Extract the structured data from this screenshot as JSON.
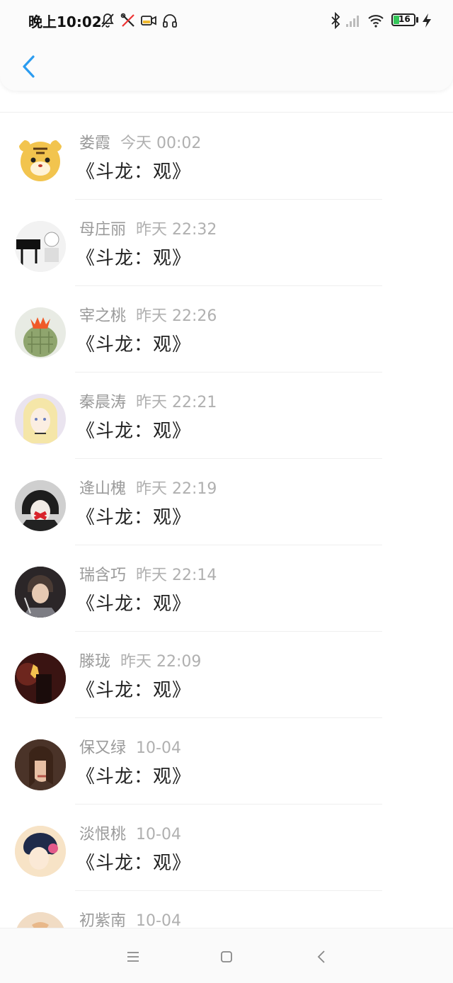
{
  "status_bar": {
    "time": "晚上10:02",
    "battery": "16"
  },
  "header": {
    "back_icon": "chevron-left-icon"
  },
  "comments": [
    {
      "name": "娄霞",
      "time": "今天 00:02",
      "text": "《斗龙：观》",
      "avatar_color": "#f2c44e"
    },
    {
      "name": "母庄丽",
      "time": "昨天 22:32",
      "text": "《斗龙：观》",
      "avatar_color": "#e8e8e8"
    },
    {
      "name": "宰之桃",
      "time": "昨天 22:26",
      "text": "《斗龙：观》",
      "avatar_color": "#8fa56e"
    },
    {
      "name": "秦晨涛",
      "time": "昨天 22:21",
      "text": "《斗龙：观》",
      "avatar_color": "#e3dceb"
    },
    {
      "name": "逄山槐",
      "time": "昨天 22:19",
      "text": "《斗龙：观》",
      "avatar_color": "#3a3a3a"
    },
    {
      "name": "瑞含巧",
      "time": "昨天 22:14",
      "text": "《斗龙：观》",
      "avatar_color": "#2b2628"
    },
    {
      "name": "滕珑",
      "time": "昨天 22:09",
      "text": "《斗龙：观》",
      "avatar_color": "#5a1e1c"
    },
    {
      "name": "保又绿",
      "time": "10-04",
      "text": "《斗龙：观》",
      "avatar_color": "#6b4a38"
    },
    {
      "name": "淡恨桃",
      "time": "10-04",
      "text": "《斗龙：观》",
      "avatar_color": "#f3d9b8"
    },
    {
      "name": "初紫南",
      "time": "10-04",
      "text": "",
      "avatar_color": "#f1dcc4"
    }
  ],
  "nav": {
    "menu_icon": "menu-icon",
    "home_icon": "home-square-icon",
    "back_icon": "back-triangle-icon"
  }
}
